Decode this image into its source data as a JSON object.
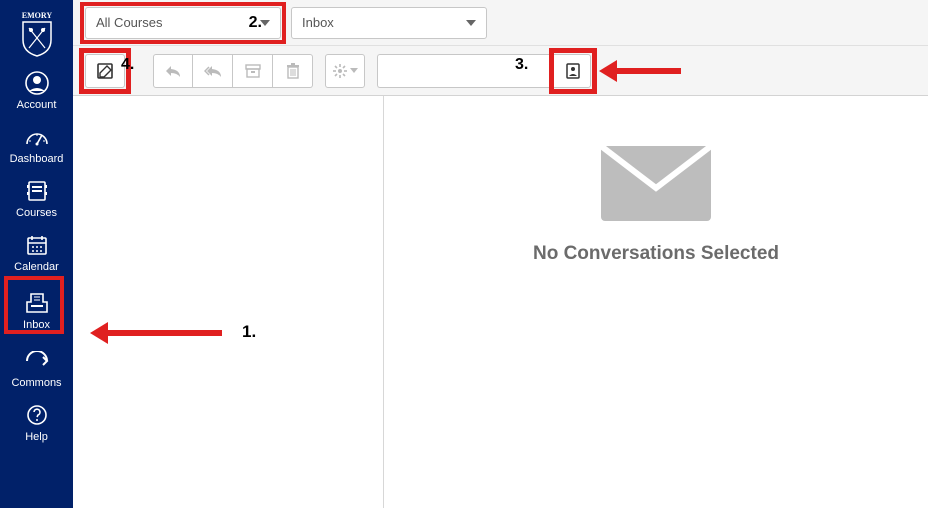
{
  "brand": "EMORY",
  "nav": {
    "account": "Account",
    "dashboard": "Dashboard",
    "courses": "Courses",
    "calendar": "Calendar",
    "inbox": "Inbox",
    "commons": "Commons",
    "help": "Help"
  },
  "filters": {
    "course_label": "All Courses",
    "mailbox_label": "Inbox"
  },
  "search": {
    "placeholder": ""
  },
  "empty_state": "No Conversations Selected",
  "annotations": {
    "n1": "1.",
    "n2": "2.",
    "n3": "3.",
    "n4": "4."
  }
}
